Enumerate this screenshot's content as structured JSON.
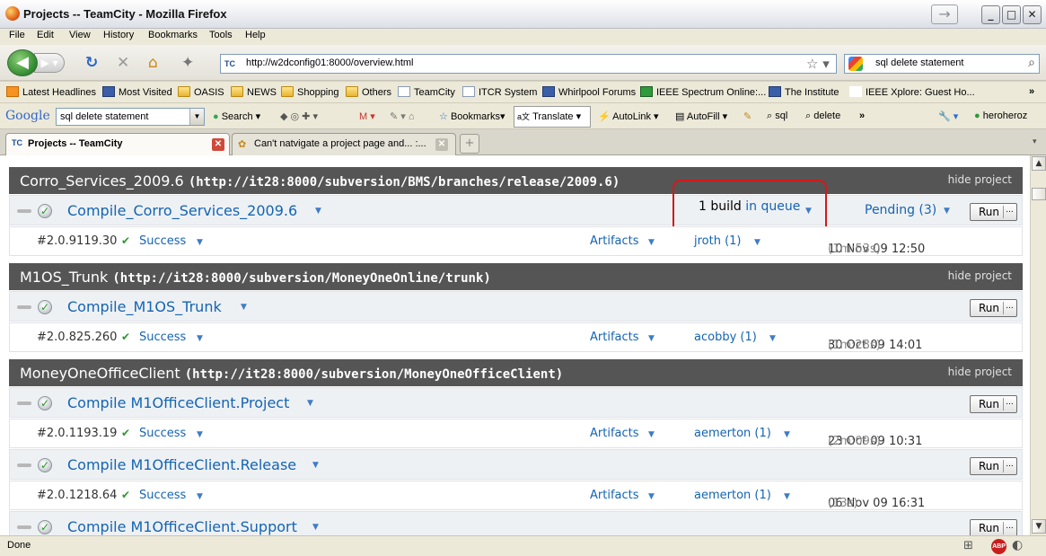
{
  "window": {
    "title": "Projects -- TeamCity - Mozilla Firefox"
  },
  "menu": {
    "items": [
      "File",
      "Edit",
      "View",
      "History",
      "Bookmarks",
      "Tools",
      "Help"
    ]
  },
  "nav": {
    "url": "http://w2dconfig01:8000/overview.html",
    "search_value": "sql delete statement"
  },
  "bookmarks": [
    "Latest Headlines",
    "Most Visited",
    "OASIS",
    "NEWS",
    "Shopping",
    "Others",
    "TeamCity",
    "ITCR System",
    "Whirlpool Forums",
    "IEEE Spectrum Online:...",
    "The Institute",
    "IEEE Xplore: Guest Ho..."
  ],
  "gtoolbar": {
    "logo": "Google",
    "search_value": "sql delete statement",
    "search_label": "Search",
    "bookmarks_label": "Bookmarks",
    "translate_label": "Translate",
    "autolink_label": "AutoLink",
    "autofill_label": "AutoFill",
    "sql_label": "sql",
    "delete_label": "delete",
    "user_label": "heroheroz"
  },
  "tabs": [
    {
      "label": "Projects -- TeamCity"
    },
    {
      "label": "Can't natvigate a project page and... :..."
    }
  ],
  "hide_label": "hide project",
  "run_label": "Run",
  "artifacts_label": "Artifacts",
  "success_label": "Success",
  "queue": {
    "count": "1",
    "build": "build",
    "link": "in queue"
  },
  "pending_label": "Pending (3)",
  "projects": [
    {
      "name": "Corro_Services_2009.6",
      "url": "(http://it28:8000/subversion/BMS/branches/release/2009.6)",
      "configs": [
        {
          "name": "Compile_Corro_Services_2009.6",
          "build": "#2.0.9119.30",
          "user": "jroth (1)",
          "date": "10 Nov 09 12:50",
          "duration": "(1m:53s)"
        }
      ]
    },
    {
      "name": "M1OS_Trunk",
      "url": "(http://it28:8000/subversion/MoneyOneOnline/trunk)",
      "configs": [
        {
          "name": "Compile_M1OS_Trunk",
          "build": "#2.0.825.260",
          "user": "acobby (1)",
          "date": "30 Oct 09 14:01",
          "duration": "(1m:28s)"
        }
      ]
    },
    {
      "name": "MoneyOneOfficeClient",
      "url": "(http://it28:8000/subversion/MoneyOneOfficeClient)",
      "configs": [
        {
          "name": "Compile M1OfficeClient.Project",
          "build": "#2.0.1193.19",
          "user": "aemerton (1)",
          "date": "23 Oct 09 10:31",
          "duration": "(2m:09s)"
        },
        {
          "name": "Compile M1OfficeClient.Release",
          "build": "#2.0.1218.64",
          "user": "aemerton (1)",
          "date": "06 Nov 09 16:31",
          "duration": "(13s)"
        },
        {
          "name": "Compile M1OfficeClient.Support"
        }
      ]
    }
  ],
  "status": {
    "text": "Done"
  }
}
